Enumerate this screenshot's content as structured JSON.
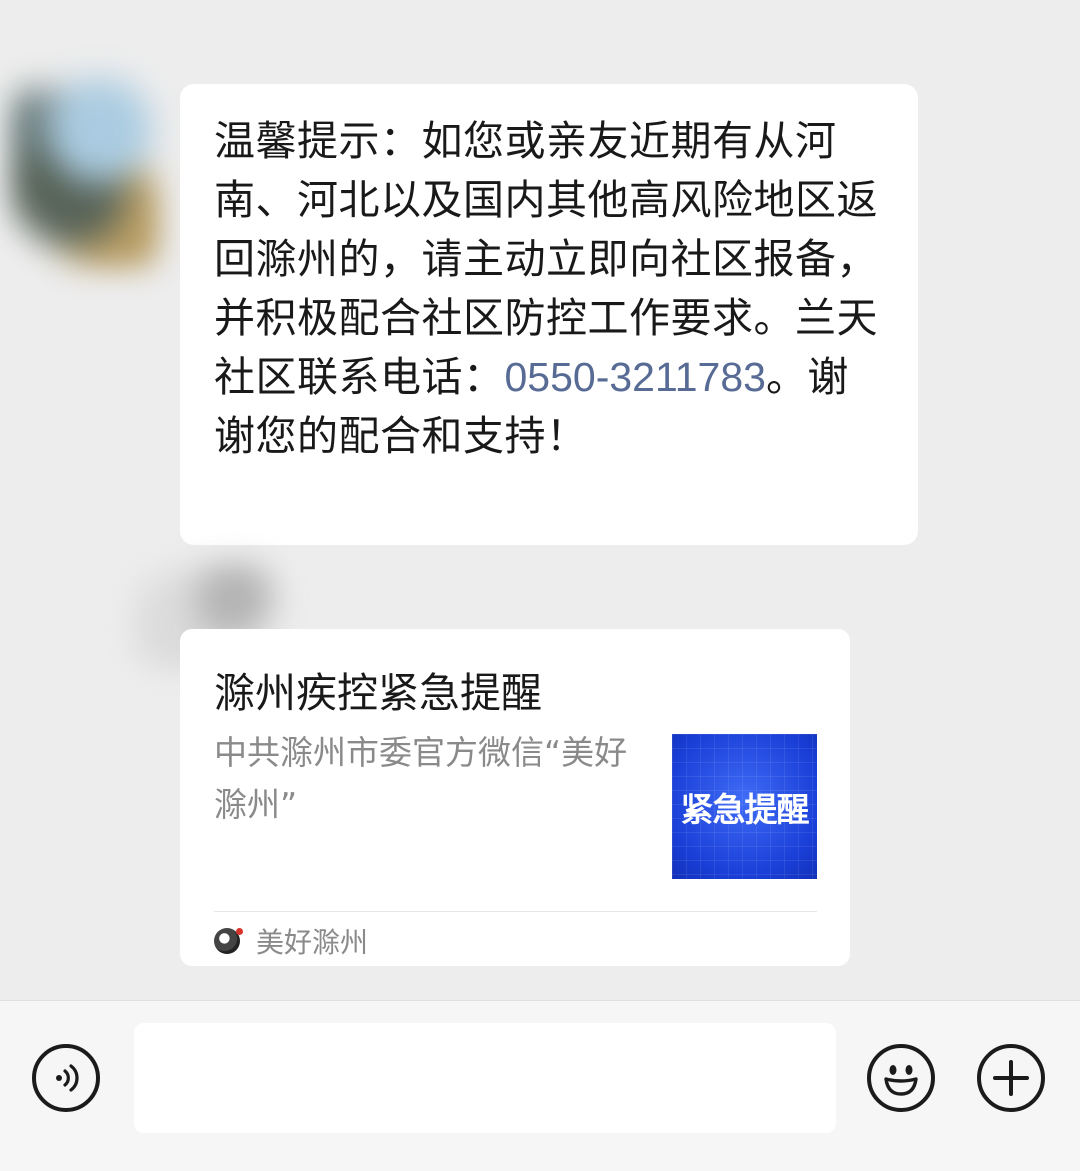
{
  "chat": {
    "messages": [
      {
        "type": "text",
        "text_before_phone": "温馨提示：如您或亲友近期有从河南、河北以及国内其他高风险地区返回滁州的，请主动立即向社区报备，并积极配合社区防控工作要求。兰天社区联系电话：",
        "phone": "0550-3211783",
        "text_after_phone": "。谢谢您的配合和支持！"
      },
      {
        "type": "link_card",
        "title": "滁州疾控紧急提醒",
        "description": "中共滁州市委官方微信“美好滁州”",
        "thumbnail_text": "紧急提醒",
        "source_name": "美好滁州"
      }
    ]
  },
  "input_bar": {
    "voice_icon": "voice-icon",
    "emoji_icon": "emoji-icon",
    "plus_icon": "plus-icon",
    "input_value": ""
  },
  "colors": {
    "chat_background": "#ededed",
    "bubble_background": "#ffffff",
    "link_color": "#576b95",
    "thumbnail_blue": "#1a3fd8"
  }
}
